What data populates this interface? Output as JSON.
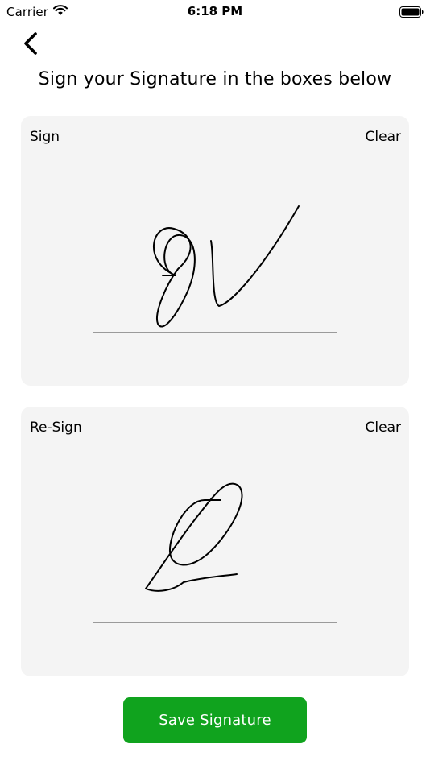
{
  "status_bar": {
    "carrier": "Carrier",
    "time": "6:18 PM",
    "wifi_icon": "wifi-icon",
    "battery_icon": "battery-icon"
  },
  "nav": {
    "back_icon": "chevron-left-icon"
  },
  "title": "Sign your Signature in the boxes below",
  "sign_panel": {
    "label": "Sign",
    "clear_label": "Clear"
  },
  "resign_panel": {
    "label": "Re-Sign",
    "clear_label": "Clear"
  },
  "save_button": {
    "label": "Save Signature"
  },
  "colors": {
    "accent": "#10a31e",
    "panel_background": "#f4f4f4",
    "signature_line": "#9a9a9a"
  }
}
